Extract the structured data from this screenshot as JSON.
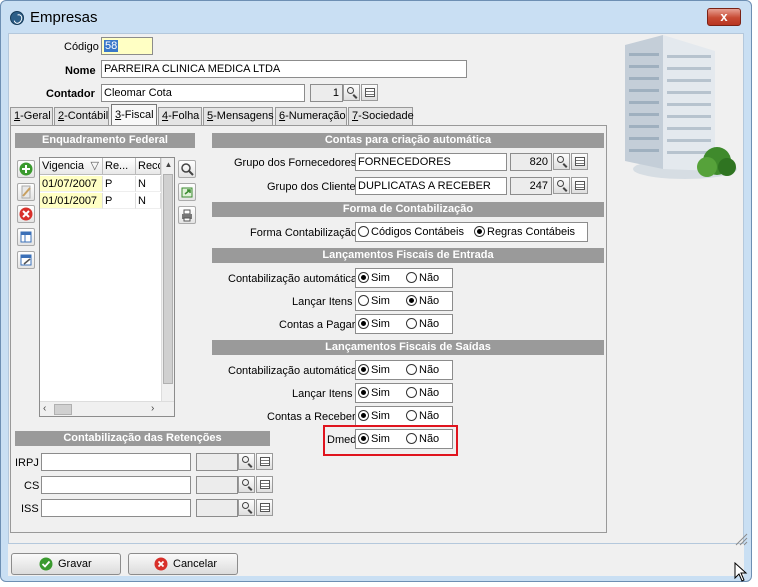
{
  "window": {
    "title": "Empresas",
    "close_label": "x"
  },
  "header": {
    "codigo_label": "Código",
    "codigo_value": "58",
    "nome_label": "Nome",
    "nome_value": "PARREIRA CLINICA MEDICA LTDA",
    "contador_label": "Contador",
    "contador_value": "Cleomar Cota",
    "contador_code": "1"
  },
  "tabs": [
    {
      "key": "1",
      "label": "-Geral"
    },
    {
      "key": "2",
      "label": "-Contábil"
    },
    {
      "key": "3",
      "label": "-Fiscal",
      "active": true
    },
    {
      "key": "4",
      "label": "-Folha"
    },
    {
      "key": "5",
      "label": "-Mensagens"
    },
    {
      "key": "6",
      "label": "-Numeração"
    },
    {
      "key": "7",
      "label": "-Sociedade"
    }
  ],
  "enquadramento": {
    "title": "Enquadramento Federal",
    "columns": [
      "Vigencia",
      "Re...",
      "Reco"
    ],
    "rows": [
      {
        "vigencia": "01/07/2007",
        "re": "P",
        "reco": "N"
      },
      {
        "vigencia": "01/01/2007",
        "re": "P",
        "reco": "N"
      }
    ]
  },
  "retencoes": {
    "title": "Contabilização das Retenções",
    "fields": [
      {
        "label": "IRPJ"
      },
      {
        "label": "CS"
      },
      {
        "label": "ISS"
      }
    ]
  },
  "contas": {
    "title": "Contas para criação automática",
    "fornecedores_label": "Grupo dos Fornecedores",
    "fornecedores_value": "FORNECEDORES",
    "fornecedores_code": "820",
    "cliente_label": "Grupo dos Cliente",
    "cliente_value": "DUPLICATAS A RECEBER",
    "cliente_code": "247"
  },
  "forma": {
    "title": "Forma de Contabilização",
    "label": "Forma Contabilização",
    "opt1": "Códigos Contábeis",
    "opt2": "Regras Contábeis",
    "selected": "Regras Contábeis"
  },
  "entrada": {
    "title": "Lançamentos Fiscais de Entrada",
    "rows": [
      {
        "label": "Contabilização automática",
        "value": "Sim"
      },
      {
        "label": "Lançar Itens",
        "value": "Não"
      },
      {
        "label": "Contas a Pagar",
        "value": "Sim"
      }
    ]
  },
  "saidas": {
    "title": "Lançamentos Fiscais de Saídas",
    "rows": [
      {
        "label": "Contabilização automática",
        "value": "Sim"
      },
      {
        "label": "Lançar Itens",
        "value": "Sim"
      },
      {
        "label": "Contas a Receber",
        "value": "Sim"
      }
    ]
  },
  "dmed": {
    "label": "Dmed",
    "value": "Sim",
    "highlight_color": "#e0141e"
  },
  "options": {
    "sim": "Sim",
    "nao": "Não"
  },
  "buttons": {
    "gravar": "Gravar",
    "cancelar": "Cancelar"
  }
}
